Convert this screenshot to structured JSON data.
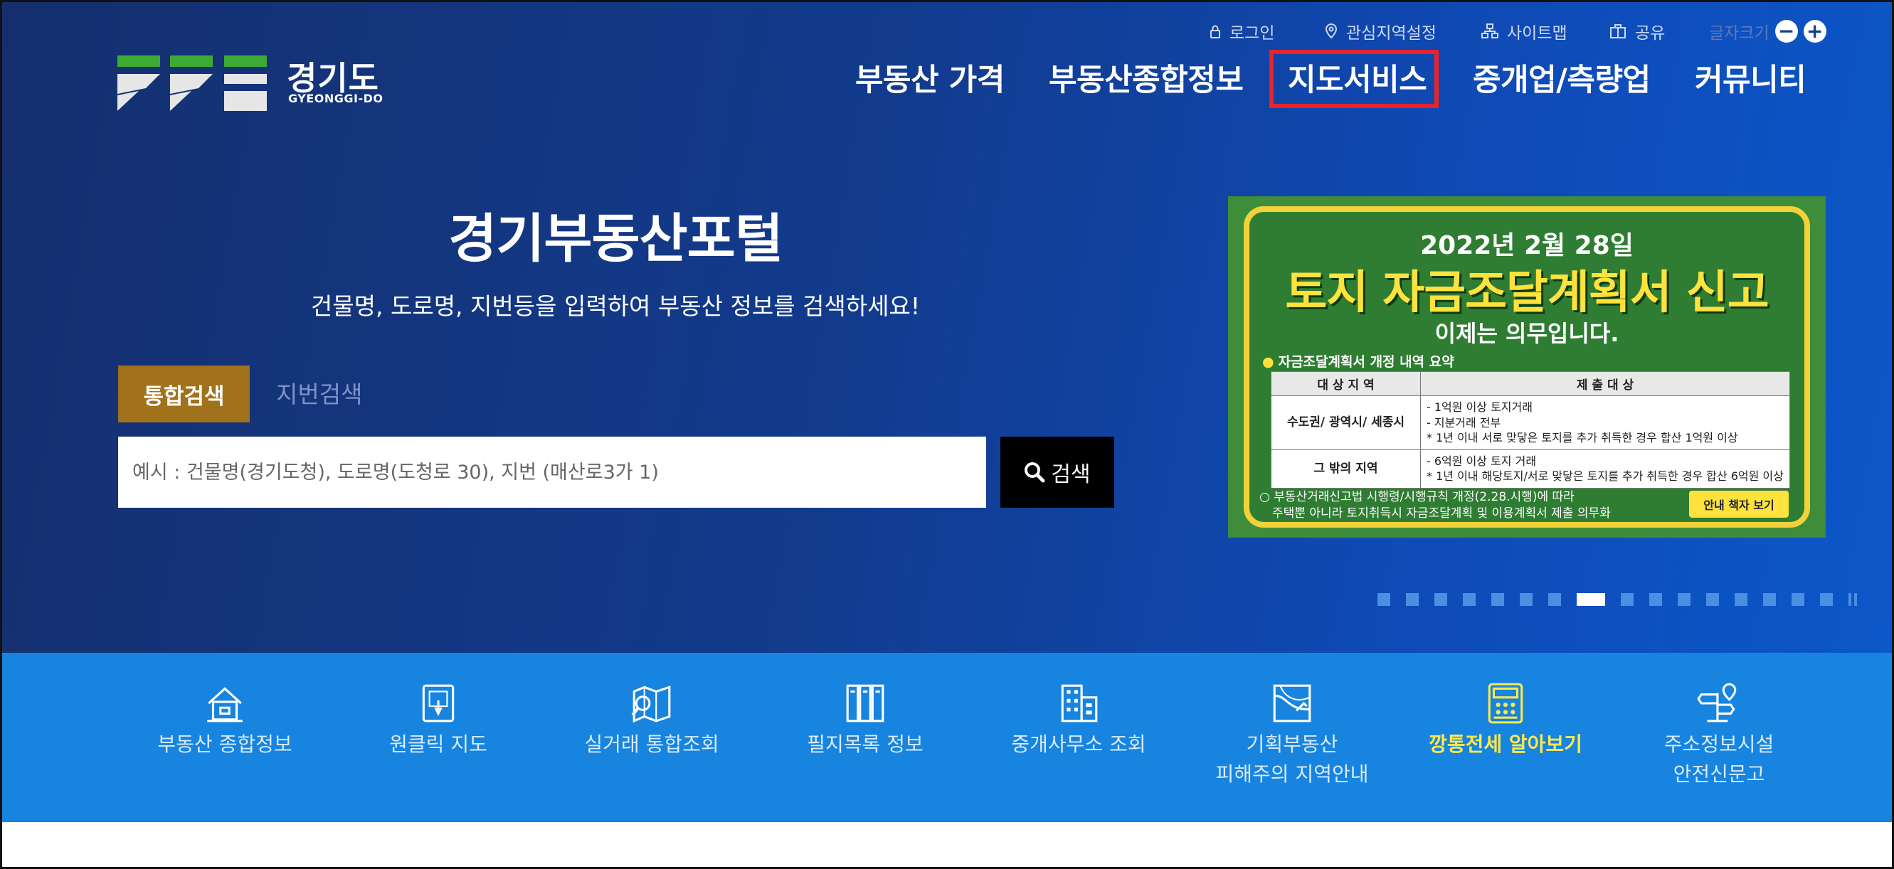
{
  "logo": {
    "name_ko": "경기도",
    "name_en": "GYEONGGI-DO"
  },
  "utility": {
    "login": "로그인",
    "region_setting": "관심지역설정",
    "sitemap": "사이트맵",
    "share": "공유",
    "font_size": "글자크기",
    "font_minus": "−",
    "font_plus": "+"
  },
  "nav": {
    "items": [
      "부동산 가격",
      "부동산종합정보",
      "지도서비스",
      "중개업/측량업",
      "커뮤니티"
    ],
    "highlighted": "지도서비스",
    "highlight_color": "#e8232a"
  },
  "hero": {
    "title": "경기부동산포털",
    "subtitle": "건물명, 도로명, 지번등을 입력하여 부동산 정보를 검색하세요!"
  },
  "search": {
    "tabs": [
      "통합검색",
      "지번검색"
    ],
    "active_tab": "통합검색",
    "placeholder": "예시 : 건물명(경기도청), 도로명(도청로 30), 지번 (매산로3가 1)",
    "value": "",
    "button_label": "검색"
  },
  "banner": {
    "date": "2022년 2월 28일",
    "title": "토지 자금조달계획서 신고",
    "subtitle": "이제는 의무입니다.",
    "summary": "자금조달계획서 개정 내역 요약",
    "table_headers": [
      "대 상 지 역",
      "제 출 대 상"
    ],
    "rows": [
      {
        "region": "수도권/ 광역시/ 세종시",
        "lines": [
          "- 1억원 이상 토지거래",
          "- 지분거래 전부",
          "* 1년 이내 서로 맞닿은 토지를 추가 취득한 경우 합산 1억원 이상"
        ]
      },
      {
        "region": "그 밖의 지역",
        "lines": [
          "- 6억원 이상 토지 거래",
          "* 1년 이내 해당토지/서로 맞닿은 토지를 추가 취득한 경우 합산 6억원 이상"
        ]
      }
    ],
    "note_line1": "○ 부동산거래신고법 시행령/시행규칙 개정(2.28.시행)에 따라",
    "note_line2": "주택뿐 아니라 토지취득시 자금조달계획 및 이용계획서 제출 의무화",
    "guide_button": "안내 책자 보기",
    "colors": {
      "background": "#3f8d3a",
      "accent": "#ffe23c"
    }
  },
  "slider": {
    "total": 16,
    "active_index": 7
  },
  "quick_menu": [
    {
      "lines": [
        "부동산 종합정보"
      ],
      "icon": "house-icon"
    },
    {
      "lines": [
        "원클릭 지도"
      ],
      "icon": "touch-map-icon"
    },
    {
      "lines": [
        "실거래 통합조회"
      ],
      "icon": "map-search-icon"
    },
    {
      "lines": [
        "필지목록 정보"
      ],
      "icon": "file-cabinet-icon"
    },
    {
      "lines": [
        "중개사무소 조회"
      ],
      "icon": "building-icon"
    },
    {
      "lines": [
        "기획부동산",
        "피해주의 지역안내"
      ],
      "icon": "road-map-icon"
    },
    {
      "lines": [
        "깡통전세 알아보기"
      ],
      "icon": "calculator-icon",
      "highlight": true
    },
    {
      "lines": [
        "주소정보시설",
        "안전신문고"
      ],
      "icon": "signpost-icon"
    }
  ],
  "colors": {
    "hero_bg": "#123b8d",
    "quick_menu_bg": "#1784e0",
    "active_tab": "#a2711b",
    "highlight_text": "#ffe94a"
  }
}
